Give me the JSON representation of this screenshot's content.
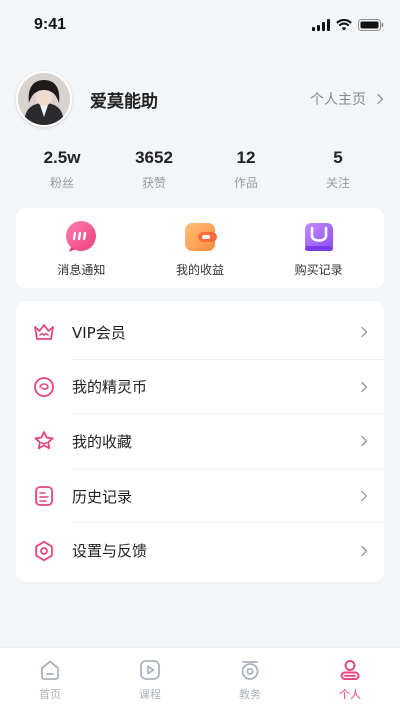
{
  "status_bar": {
    "time": "9:41"
  },
  "profile": {
    "username": "爱莫能助",
    "homepage_label": "个人主页"
  },
  "stats": [
    {
      "value": "2.5w",
      "label": "粉丝"
    },
    {
      "value": "3652",
      "label": "获赞"
    },
    {
      "value": "12",
      "label": "作品"
    },
    {
      "value": "5",
      "label": "关注"
    }
  ],
  "quick_actions": [
    {
      "label": "消息通知",
      "icon": "message-icon"
    },
    {
      "label": "我的收益",
      "icon": "wallet-icon"
    },
    {
      "label": "购买记录",
      "icon": "shopping-bag-icon"
    }
  ],
  "menu": [
    {
      "label": "VIP会员",
      "icon": "crown-icon"
    },
    {
      "label": "我的精灵币",
      "icon": "coin-icon"
    },
    {
      "label": "我的收藏",
      "icon": "star-icon"
    },
    {
      "label": "历史记录",
      "icon": "history-icon"
    },
    {
      "label": "设置与反馈",
      "icon": "settings-icon"
    }
  ],
  "tabbar": {
    "tabs": [
      {
        "label": "首页",
        "icon": "home-icon",
        "active": false
      },
      {
        "label": "课程",
        "icon": "play-icon",
        "active": false
      },
      {
        "label": "教务",
        "icon": "academic-icon",
        "active": false
      },
      {
        "label": "个人",
        "icon": "user-icon",
        "active": true
      }
    ]
  },
  "colors": {
    "accent": "#e8457a",
    "inactive": "#aab3bd",
    "background": "#f3f6f9"
  }
}
